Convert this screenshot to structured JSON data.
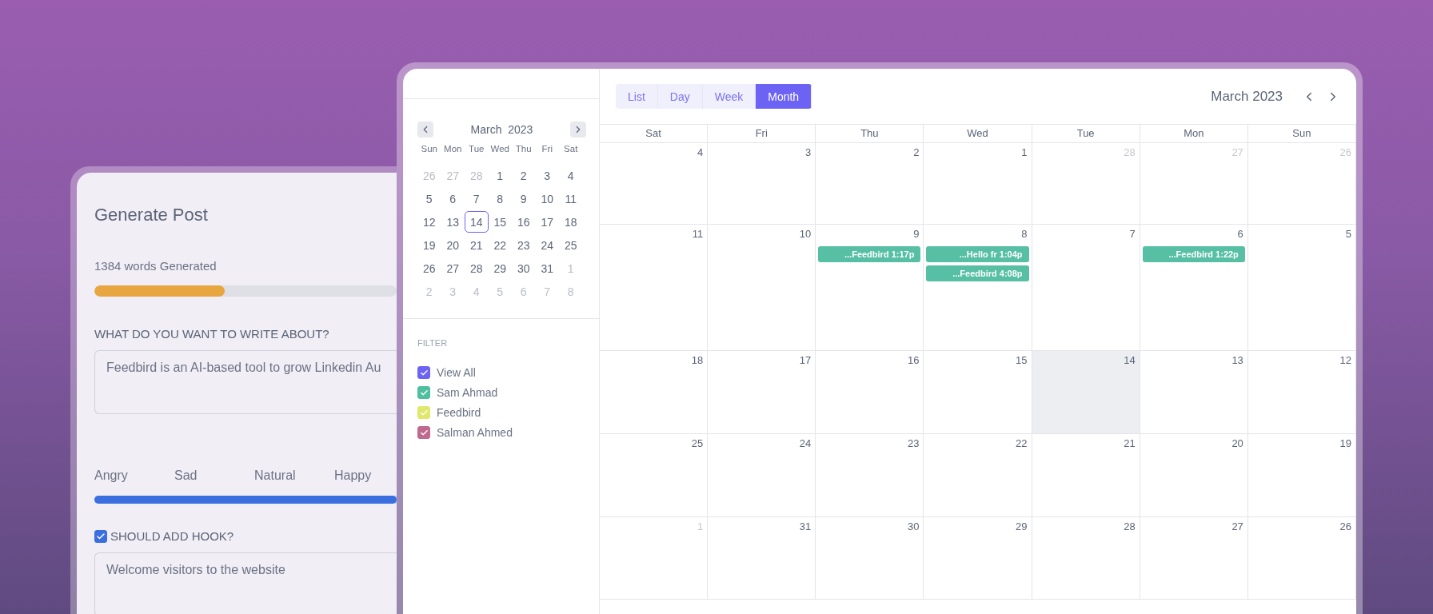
{
  "post_panel": {
    "title": "Generate Post",
    "words_generated": "1384 words Generated",
    "progress": {
      "level": 0.43
    },
    "topic": {
      "label": "WHAT DO YOU WANT TO WRITE ABOUT?",
      "value": "Feedbird is an AI-based tool to grow Linkedin Au"
    },
    "tone": {
      "labels": [
        "Angry",
        "Sad",
        "Natural",
        "Happy"
      ],
      "level": 1
    },
    "hook": {
      "label": "SHOULD ADD HOOK?",
      "checked": true,
      "value": "Welcome visitors to the website"
    }
  },
  "calendar": {
    "mini": {
      "month": "March",
      "year": "2023",
      "weekdays": [
        "Sun",
        "Mon",
        "Tue",
        "Wed",
        "Thu",
        "Fri",
        "Sat"
      ],
      "weeks": [
        [
          {
            "day": "26",
            "muted": true,
            "selected": false
          },
          {
            "day": "27",
            "muted": true,
            "selected": false
          },
          {
            "day": "28",
            "muted": true,
            "selected": false
          },
          {
            "day": "1",
            "muted": false,
            "selected": false
          },
          {
            "day": "2",
            "muted": false,
            "selected": false
          },
          {
            "day": "3",
            "muted": false,
            "selected": false
          },
          {
            "day": "4",
            "muted": false,
            "selected": false
          }
        ],
        [
          {
            "day": "5",
            "muted": false,
            "selected": false
          },
          {
            "day": "6",
            "muted": false,
            "selected": false
          },
          {
            "day": "7",
            "muted": false,
            "selected": false
          },
          {
            "day": "8",
            "muted": false,
            "selected": false
          },
          {
            "day": "9",
            "muted": false,
            "selected": false
          },
          {
            "day": "10",
            "muted": false,
            "selected": false
          },
          {
            "day": "11",
            "muted": false,
            "selected": false
          }
        ],
        [
          {
            "day": "12",
            "muted": false,
            "selected": false
          },
          {
            "day": "13",
            "muted": false,
            "selected": false
          },
          {
            "day": "14",
            "muted": false,
            "selected": true
          },
          {
            "day": "15",
            "muted": false,
            "selected": false
          },
          {
            "day": "16",
            "muted": false,
            "selected": false
          },
          {
            "day": "17",
            "muted": false,
            "selected": false
          },
          {
            "day": "18",
            "muted": false,
            "selected": false
          }
        ],
        [
          {
            "day": "19",
            "muted": false,
            "selected": false
          },
          {
            "day": "20",
            "muted": false,
            "selected": false
          },
          {
            "day": "21",
            "muted": false,
            "selected": false
          },
          {
            "day": "22",
            "muted": false,
            "selected": false
          },
          {
            "day": "23",
            "muted": false,
            "selected": false
          },
          {
            "day": "24",
            "muted": false,
            "selected": false
          },
          {
            "day": "25",
            "muted": false,
            "selected": false
          }
        ],
        [
          {
            "day": "26",
            "muted": false,
            "selected": false
          },
          {
            "day": "27",
            "muted": false,
            "selected": false
          },
          {
            "day": "28",
            "muted": false,
            "selected": false
          },
          {
            "day": "29",
            "muted": false,
            "selected": false
          },
          {
            "day": "30",
            "muted": false,
            "selected": false
          },
          {
            "day": "31",
            "muted": false,
            "selected": false
          },
          {
            "day": "1",
            "muted": true,
            "selected": false
          }
        ],
        [
          {
            "day": "2",
            "muted": true,
            "selected": false
          },
          {
            "day": "3",
            "muted": true,
            "selected": false
          },
          {
            "day": "4",
            "muted": true,
            "selected": false
          },
          {
            "day": "5",
            "muted": true,
            "selected": false
          },
          {
            "day": "6",
            "muted": true,
            "selected": false
          },
          {
            "day": "7",
            "muted": true,
            "selected": false
          },
          {
            "day": "8",
            "muted": true,
            "selected": false
          }
        ]
      ]
    },
    "filter": {
      "title": "FILTER",
      "items": [
        {
          "label": "View All",
          "checked": true,
          "color": "#6c63f5"
        },
        {
          "label": "Sam Ahmad",
          "checked": true,
          "color": "#4fbf9f"
        },
        {
          "label": "Feedbird",
          "checked": true,
          "color": "#dfe86a"
        },
        {
          "label": "Salman Ahmed",
          "checked": true,
          "color": "#c0698f"
        }
      ]
    },
    "views": [
      {
        "label": "List",
        "selected": false
      },
      {
        "label": "Day",
        "selected": false
      },
      {
        "label": "Week",
        "selected": false
      },
      {
        "label": "Month",
        "selected": true
      }
    ],
    "title": "March 2023",
    "weekdays": [
      "Sat",
      "Fri",
      "Thu",
      "Wed",
      "Tue",
      "Mon",
      "Sun"
    ],
    "weeks": [
      [
        {
          "day": "4",
          "muted": false,
          "selected": false
        },
        {
          "day": "3",
          "muted": false,
          "selected": false
        },
        {
          "day": "2",
          "muted": false,
          "selected": false
        },
        {
          "day": "1",
          "muted": false,
          "selected": false
        },
        {
          "day": "28",
          "muted": true,
          "selected": false
        },
        {
          "day": "27",
          "muted": true,
          "selected": false
        },
        {
          "day": "26",
          "muted": true,
          "selected": false
        }
      ],
      [
        {
          "day": "11",
          "muted": false,
          "selected": false
        },
        {
          "day": "10",
          "muted": false,
          "selected": false
        },
        {
          "day": "9",
          "muted": false,
          "selected": false,
          "events": [
            "...Feedbird 1:17p"
          ]
        },
        {
          "day": "8",
          "muted": false,
          "selected": false,
          "events": [
            "...Hello fr 1:04p",
            "...Feedbird 4:08p"
          ]
        },
        {
          "day": "7",
          "muted": false,
          "selected": false
        },
        {
          "day": "6",
          "muted": false,
          "selected": false,
          "events": [
            "...Feedbird 1:22p"
          ]
        },
        {
          "day": "5",
          "muted": false,
          "selected": false
        }
      ],
      [
        {
          "day": "18",
          "muted": false,
          "selected": false
        },
        {
          "day": "17",
          "muted": false,
          "selected": false
        },
        {
          "day": "16",
          "muted": false,
          "selected": false
        },
        {
          "day": "15",
          "muted": false,
          "selected": false
        },
        {
          "day": "14",
          "muted": false,
          "selected": true
        },
        {
          "day": "13",
          "muted": false,
          "selected": false
        },
        {
          "day": "12",
          "muted": false,
          "selected": false
        }
      ],
      [
        {
          "day": "25",
          "muted": false,
          "selected": false
        },
        {
          "day": "24",
          "muted": false,
          "selected": false
        },
        {
          "day": "23",
          "muted": false,
          "selected": false
        },
        {
          "day": "22",
          "muted": false,
          "selected": false
        },
        {
          "day": "21",
          "muted": false,
          "selected": false
        },
        {
          "day": "20",
          "muted": false,
          "selected": false
        },
        {
          "day": "19",
          "muted": false,
          "selected": false
        }
      ],
      [
        {
          "day": "1",
          "muted": true,
          "selected": false
        },
        {
          "day": "31",
          "muted": false,
          "selected": false
        },
        {
          "day": "30",
          "muted": false,
          "selected": false
        },
        {
          "day": "29",
          "muted": false,
          "selected": false
        },
        {
          "day": "28",
          "muted": false,
          "selected": false
        },
        {
          "day": "27",
          "muted": false,
          "selected": false
        },
        {
          "day": "26",
          "muted": false,
          "selected": false
        }
      ]
    ]
  }
}
